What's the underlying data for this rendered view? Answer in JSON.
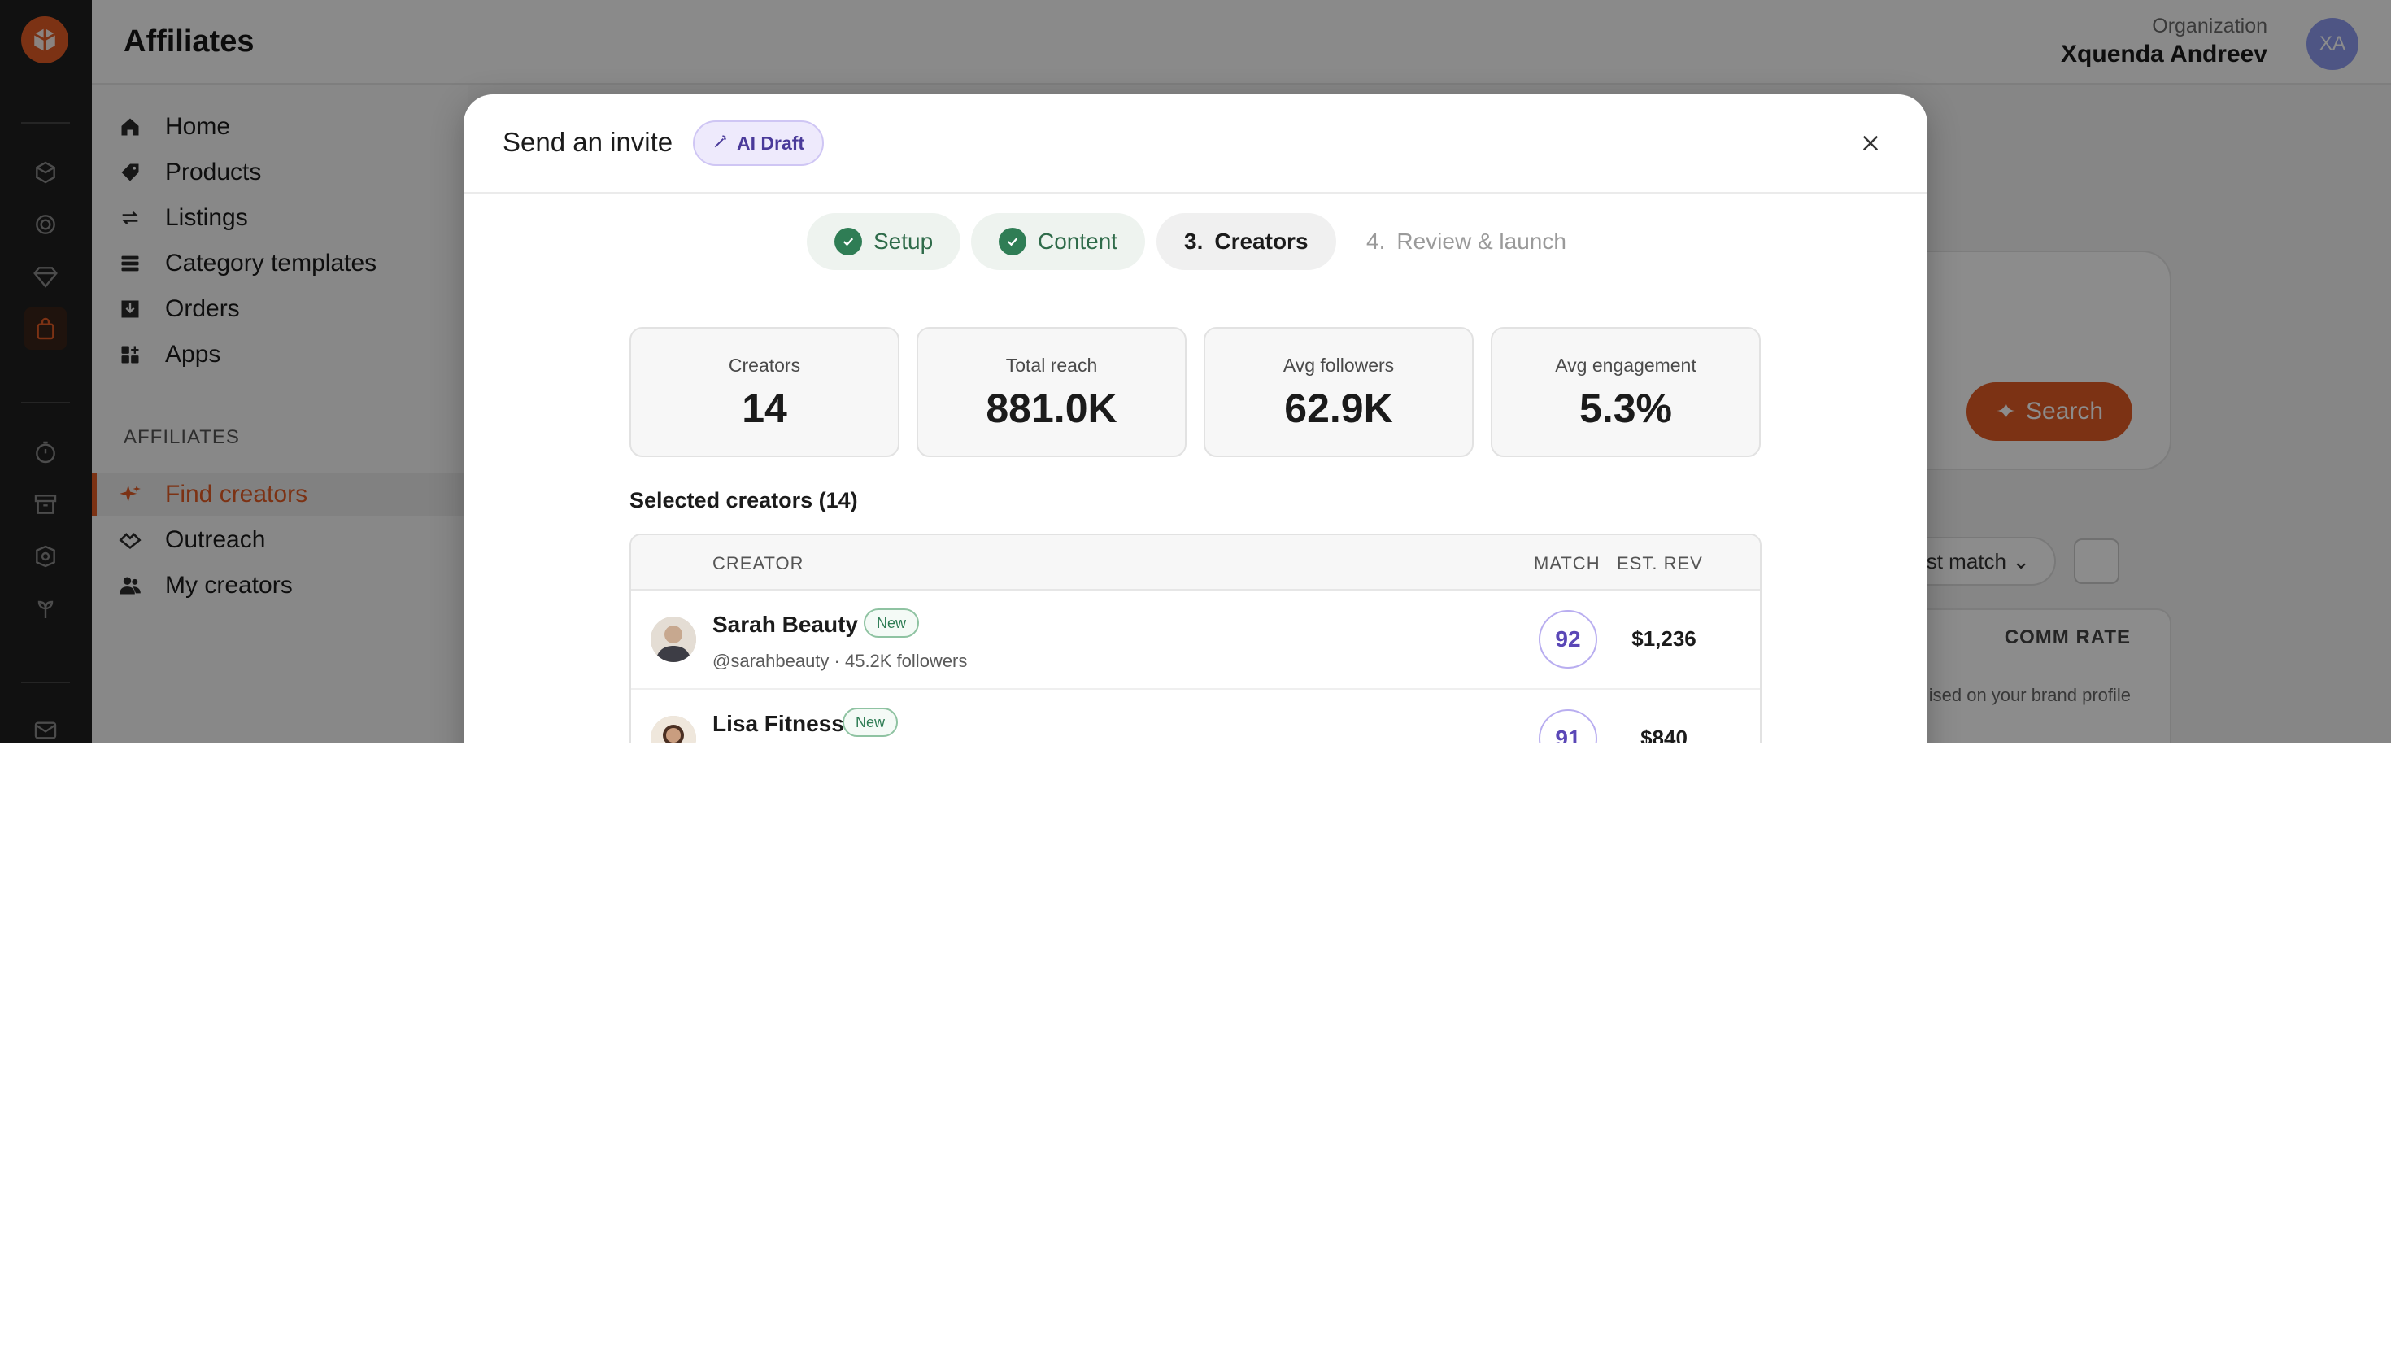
{
  "app": {
    "title": "Affiliates",
    "org_label": "Organization",
    "org_name": "Xquenda Andreev",
    "avatar_initials": "XA",
    "accent_color": "#e25b25"
  },
  "sidebar": {
    "items": [
      {
        "label": "Home",
        "icon": "home-icon"
      },
      {
        "label": "Products",
        "icon": "tag-icon"
      },
      {
        "label": "Listings",
        "icon": "repeat-icon"
      },
      {
        "label": "Category templates",
        "icon": "stack-icon"
      },
      {
        "label": "Orders",
        "icon": "inbox-download-icon"
      },
      {
        "label": "Apps",
        "icon": "apps-icon"
      }
    ],
    "section_label": "AFFILIATES",
    "affiliate_items": [
      {
        "label": "Find creators",
        "icon": "sparkle-icon",
        "active": true
      },
      {
        "label": "Outreach",
        "icon": "handshake-icon"
      },
      {
        "label": "My creators",
        "icon": "users-icon"
      }
    ]
  },
  "background": {
    "search_label": "Search",
    "sort_label": "est match",
    "comm_rate": "COMM RATE",
    "brand_hint": "ised on your brand profile"
  },
  "modal": {
    "title": "Send an invite",
    "badge": "AI Draft",
    "steps": [
      {
        "label": "Setup",
        "state": "done"
      },
      {
        "label": "Content",
        "state": "done"
      },
      {
        "number": "3.",
        "label": "Creators",
        "state": "current"
      },
      {
        "number": "4.",
        "label": "Review & launch",
        "state": "upcoming"
      }
    ],
    "stats": [
      {
        "label": "Creators",
        "value": "14"
      },
      {
        "label": "Total reach",
        "value": "881.0K"
      },
      {
        "label": "Avg followers",
        "value": "62.9K"
      },
      {
        "label": "Avg engagement",
        "value": "5.3%"
      }
    ],
    "selected_title": "Selected creators (14)",
    "table": {
      "headers": {
        "creator": "CREATOR",
        "match": "MATCH",
        "est_rev": "EST. REV"
      },
      "rows": [
        {
          "name": "Sarah Beauty",
          "badge": "New",
          "meta": "@sarahbeauty · 45.2K followers",
          "match": "92",
          "rev": "$1,236"
        },
        {
          "name": "Lisa Fitness",
          "badge": "New",
          "meta": "",
          "match": "91",
          "rev": "$840"
        }
      ]
    }
  }
}
